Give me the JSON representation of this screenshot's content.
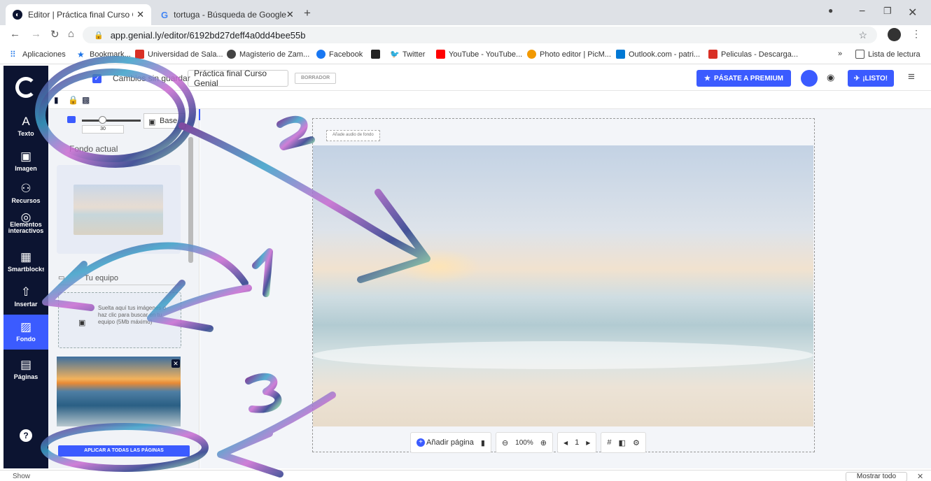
{
  "browser": {
    "tabs": [
      {
        "title": "Editor | Práctica final Curso Genia",
        "favicon": "genially-icon"
      },
      {
        "title": "tortuga - Búsqueda de Google",
        "favicon": "google-icon"
      }
    ],
    "url": "app.genial.ly/editor/6192bd27deff4a0dd4bee55b",
    "bookmarks": [
      {
        "label": "Aplicaciones",
        "color": "#1a73e8"
      },
      {
        "label": "Bookmark...",
        "color": "#1a73e8"
      },
      {
        "label": "Universidad de Sala...",
        "color": "#d93025"
      },
      {
        "label": "Magisterio de Zam...",
        "color": "#444444"
      },
      {
        "label": "Facebook",
        "color": "#1877f2"
      },
      {
        "label": "",
        "color": "#222222"
      },
      {
        "label": "Twitter",
        "color": "#1da1f2"
      },
      {
        "label": "YouTube - YouTube...",
        "color": "#ff0000"
      },
      {
        "label": "Photo editor | PicM...",
        "color": "#f29900"
      },
      {
        "label": "Outlook.com - patri...",
        "color": "#0078d4"
      },
      {
        "label": "Peliculas - Descarga...",
        "color": "#d93025"
      }
    ],
    "reading_list": "Lista de lectura",
    "overflow": "»"
  },
  "toolbar": {
    "save_status": "Cambios sin guardar",
    "project_title": "Práctica final Curso Genial",
    "draft_badge": "BORRADOR",
    "premium_label": "PÁSATE A PREMIUM",
    "ready_label": "¡LISTO!"
  },
  "rail": {
    "items": [
      {
        "label": "Texto",
        "icon": "A"
      },
      {
        "label": "Imagen",
        "icon": "▣"
      },
      {
        "label": "Recursos",
        "icon": "⚇"
      },
      {
        "label": "Elementos interactivos",
        "icon": "◎"
      },
      {
        "label": "Smartblocks",
        "icon": "▦"
      },
      {
        "label": "Insertar",
        "icon": "⇧"
      },
      {
        "label": "Fondo",
        "icon": "▨"
      },
      {
        "label": "Páginas",
        "icon": "▤"
      }
    ],
    "active": "Fondo"
  },
  "panel": {
    "opacity_value": "30",
    "base_label": "Base",
    "current_bg_label": "Fondo actual",
    "equipo_label": "Tu equipo",
    "drop_text": "Suelta aquí tus imágenes o haz clic para buscar en tu equipo (5Mb máximo)",
    "apply_all_label": "APLICAR A TODAS LAS PÁGINAS"
  },
  "canvas": {
    "audio_label": "Añade audio de fondo",
    "add_page_label": "Añadir página",
    "zoom": "100%",
    "page_number": "1"
  },
  "statusbar": {
    "left_text": "Show",
    "right_button": "Mostrar todo"
  },
  "annotations": [
    "1",
    "2",
    "3"
  ],
  "colors": {
    "accent": "#3b5bff",
    "rail_bg": "#0c1431"
  }
}
